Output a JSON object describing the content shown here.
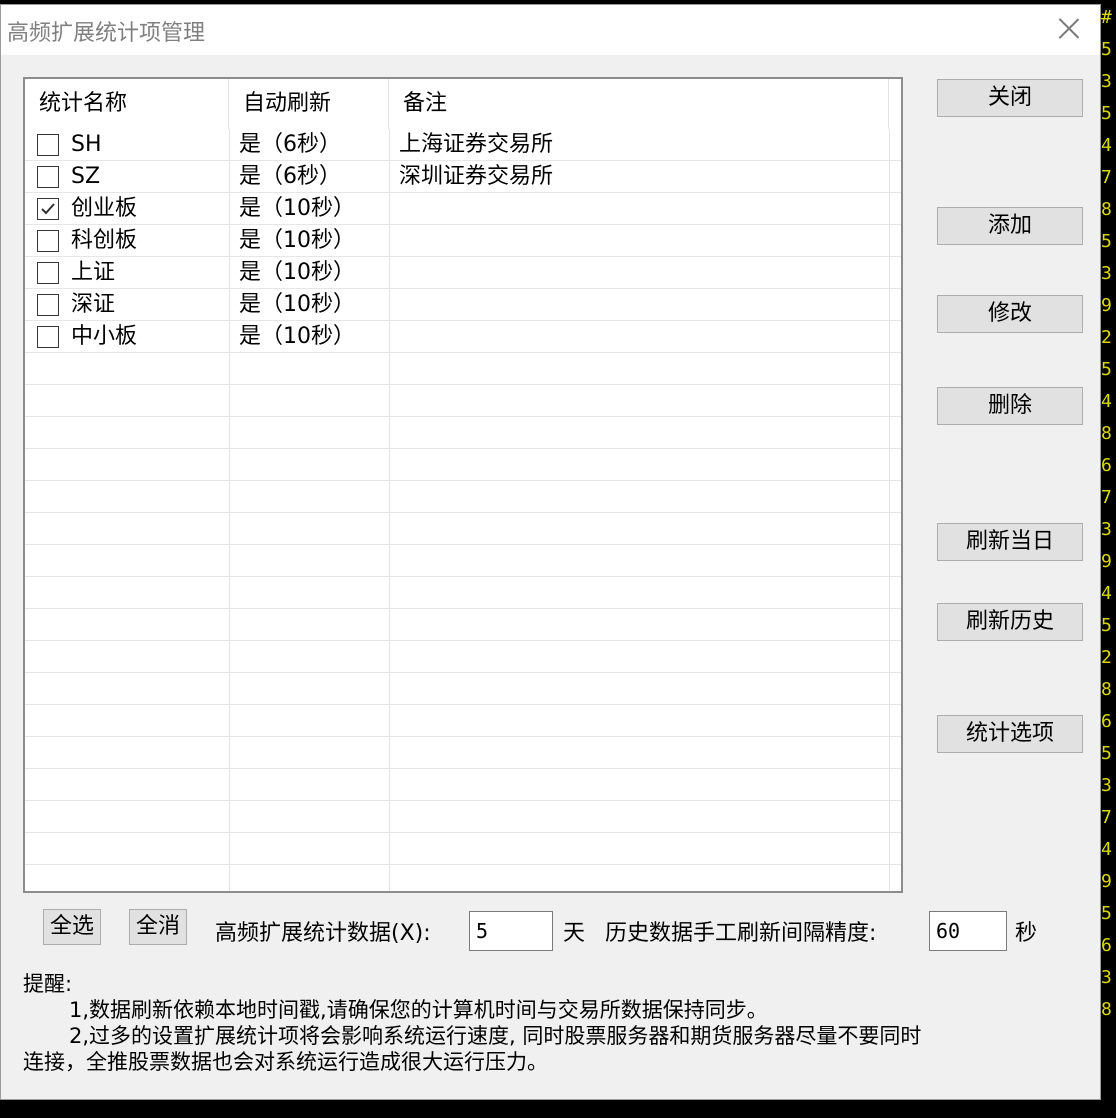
{
  "window": {
    "title": "高频扩展统计项管理"
  },
  "list": {
    "columns": [
      "统计名称",
      "自动刷新",
      "备注"
    ],
    "rows": [
      {
        "name": "SH",
        "refresh": "是（6秒）",
        "note": "上海证券交易所",
        "checked": false
      },
      {
        "name": "SZ",
        "refresh": "是（6秒）",
        "note": "深圳证券交易所",
        "checked": false
      },
      {
        "name": "创业板",
        "refresh": "是（10秒）",
        "note": "",
        "checked": true
      },
      {
        "name": "科创板",
        "refresh": "是（10秒）",
        "note": "",
        "checked": false
      },
      {
        "name": "上证",
        "refresh": "是（10秒）",
        "note": "",
        "checked": false
      },
      {
        "name": "深证",
        "refresh": "是（10秒）",
        "note": "",
        "checked": false
      },
      {
        "name": "中小板",
        "refresh": "是（10秒）",
        "note": "",
        "checked": false
      }
    ]
  },
  "buttons": {
    "close": "关闭",
    "add": "添加",
    "modify": "修改",
    "delete": "删除",
    "refresh_today": "刷新当日",
    "refresh_history": "刷新历史",
    "stat_options": "统计选项",
    "select_all": "全选",
    "deselect_all": "全消"
  },
  "bottom": {
    "hf_label": "高频扩展统计数据(X):",
    "hf_value": "5",
    "hf_unit": "天",
    "interval_label": "历史数据手工刷新间隔精度:",
    "interval_value": "60",
    "interval_unit": "秒"
  },
  "notes": {
    "title": "提醒:",
    "line1": "1,数据刷新依赖本地时间戳,请确保您的计算机时间与交易所数据保持同步。",
    "line2": "2,过多的设置扩展统计项将会影响系统运行速度, 同时股票服务器和期货服务器尽量不要同时",
    "line3": "连接，全推股票数据也会对系统运行造成很大运行压力。"
  }
}
